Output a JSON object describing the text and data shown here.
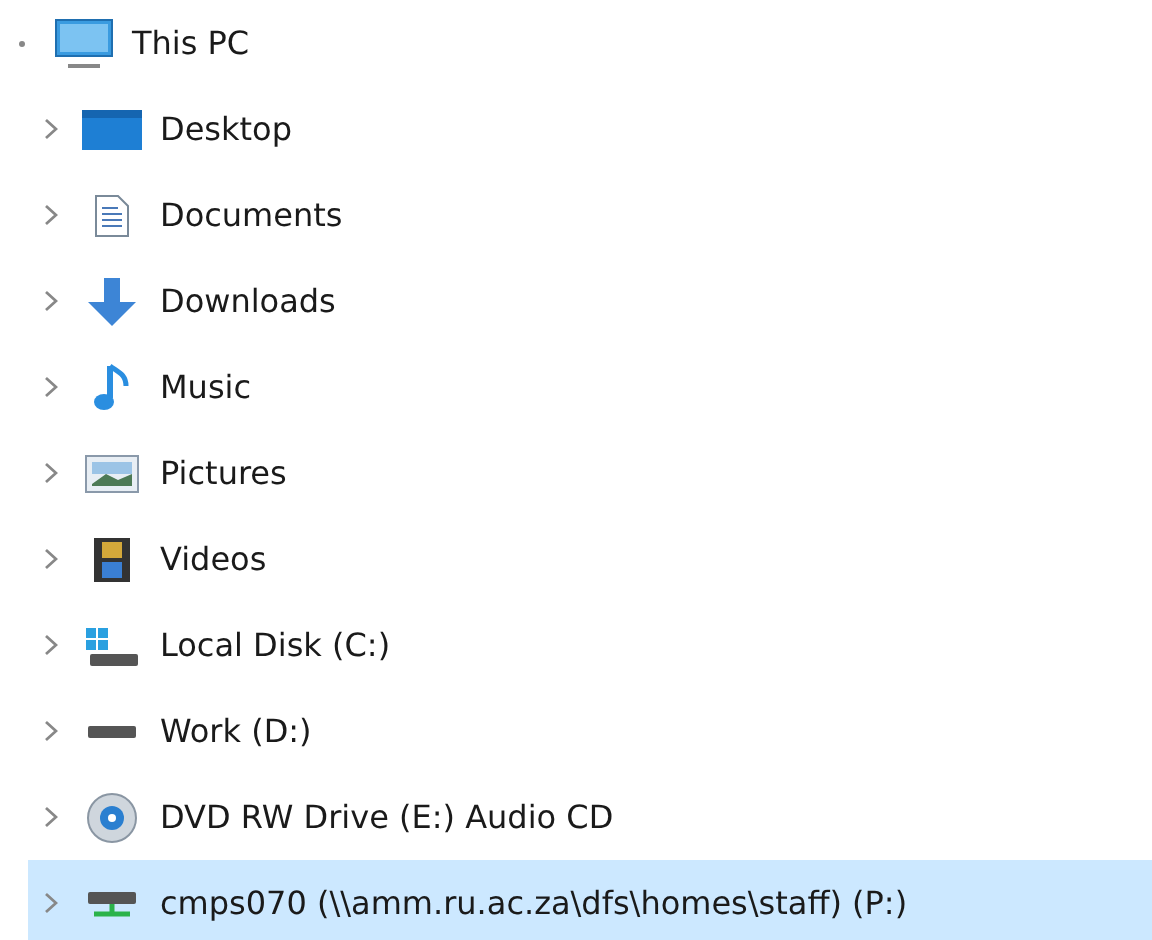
{
  "tree": [
    {
      "label": "This PC",
      "kind": "pc",
      "expanded": true,
      "selected": false,
      "children": [
        {
          "label": "Desktop",
          "kind": "desktop",
          "expanded": false,
          "selected": false
        },
        {
          "label": "Documents",
          "kind": "documents",
          "expanded": false,
          "selected": false
        },
        {
          "label": "Downloads",
          "kind": "downloads",
          "expanded": false,
          "selected": false
        },
        {
          "label": "Music",
          "kind": "music",
          "expanded": false,
          "selected": false
        },
        {
          "label": "Pictures",
          "kind": "pictures",
          "expanded": false,
          "selected": false
        },
        {
          "label": "Videos",
          "kind": "videos",
          "expanded": false,
          "selected": false
        },
        {
          "label": "Local Disk (C:)",
          "kind": "system-disk",
          "expanded": false,
          "selected": false
        },
        {
          "label": "Work (D:)",
          "kind": "disk",
          "expanded": false,
          "selected": false
        },
        {
          "label": "DVD RW Drive (E:) Audio CD",
          "kind": "dvd",
          "expanded": false,
          "selected": false
        },
        {
          "label": "cmps070 (\\\\amm.ru.ac.za\\dfs\\homes\\staff) (P:)",
          "kind": "network",
          "expanded": false,
          "selected": true
        }
      ]
    }
  ]
}
